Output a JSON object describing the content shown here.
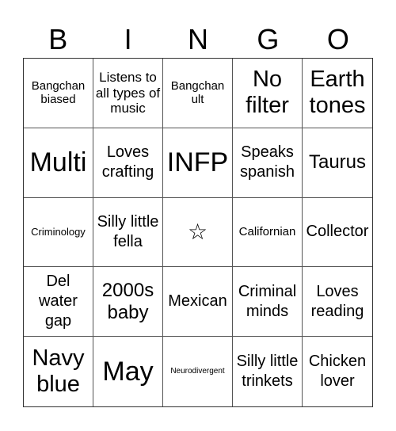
{
  "header": [
    "B",
    "I",
    "N",
    "G",
    "O"
  ],
  "cells": [
    {
      "text": "Bangchan biased",
      "size": "s3"
    },
    {
      "text": "Listens to all types of music",
      "size": "s4"
    },
    {
      "text": "Bangchan ult",
      "size": "s3"
    },
    {
      "text": "No filter",
      "size": "s7"
    },
    {
      "text": "Earth tones",
      "size": "s7"
    },
    {
      "text": "Multi",
      "size": "s8"
    },
    {
      "text": "Loves crafting",
      "size": "s5"
    },
    {
      "text": "INFP",
      "size": "s8"
    },
    {
      "text": "Speaks spanish",
      "size": "s5"
    },
    {
      "text": "Taurus",
      "size": "s6"
    },
    {
      "text": "Criminology",
      "size": "s2"
    },
    {
      "text": "Silly little fella",
      "size": "s5"
    },
    {
      "text": "☆",
      "size": "star",
      "free": true
    },
    {
      "text": "Californian",
      "size": "s3"
    },
    {
      "text": "Collector",
      "size": "s5"
    },
    {
      "text": "Del water gap",
      "size": "s5"
    },
    {
      "text": "2000s baby",
      "size": "s6"
    },
    {
      "text": "Mexican",
      "size": "s5"
    },
    {
      "text": "Criminal minds",
      "size": "s5"
    },
    {
      "text": "Loves reading",
      "size": "s5"
    },
    {
      "text": "Navy blue",
      "size": "s7"
    },
    {
      "text": "May",
      "size": "s8"
    },
    {
      "text": "Neurodivergent",
      "size": "s1"
    },
    {
      "text": "Silly little trinkets",
      "size": "s5"
    },
    {
      "text": "Chicken lover",
      "size": "s5"
    }
  ]
}
